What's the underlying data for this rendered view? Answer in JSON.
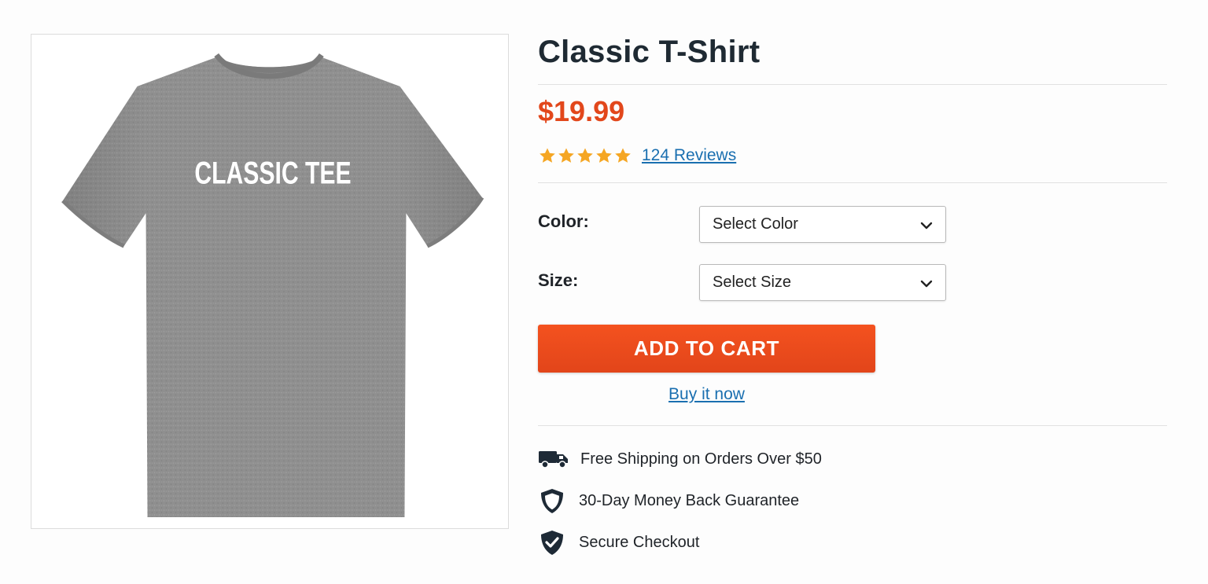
{
  "product": {
    "title": "Classic T-Shirt",
    "price": "$19.99",
    "image_print_text": "CLASSIC TEE",
    "rating_stars": 5,
    "rating_max": 5,
    "reviews_label": "124 Reviews"
  },
  "options": {
    "color_label": "Color:",
    "color_value": "Select Color",
    "size_label": "Size:",
    "size_value": "Select Size"
  },
  "actions": {
    "add_to_cart_label": "ADD TO CART",
    "buy_now_label": "Buy it now"
  },
  "features": [
    {
      "icon": "truck-icon",
      "text": "Free Shipping on Orders Over $50"
    },
    {
      "icon": "shield-icon",
      "text": "30-Day Money Back Guarantee"
    },
    {
      "icon": "shield-check-icon",
      "text": "Secure Checkout"
    }
  ],
  "colors": {
    "price": "#e2471b",
    "accent_button": "#f04e1e",
    "link": "#1a6fb0",
    "star": "#f5a623",
    "icon_dark": "#1e2a36",
    "shirt": "#8f8f8f"
  }
}
